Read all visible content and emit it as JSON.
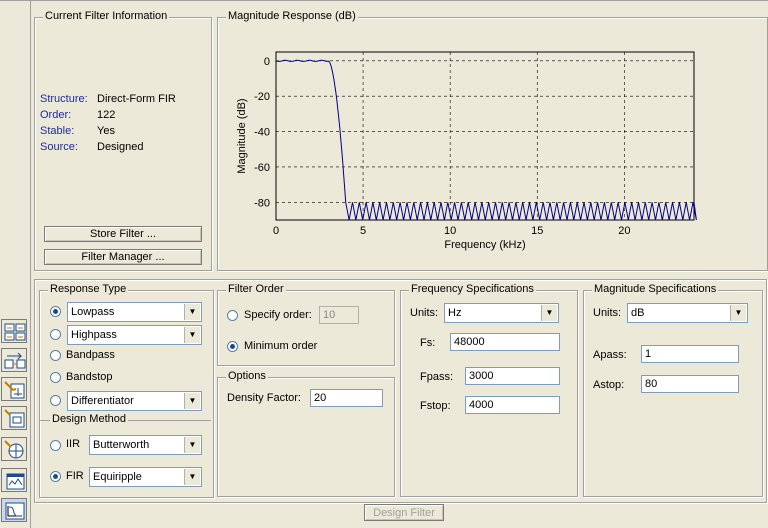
{
  "filter_info": {
    "title": "Current Filter Information",
    "rows": [
      {
        "label": "Structure:",
        "value": "Direct-Form FIR"
      },
      {
        "label": "Order:",
        "value": "122"
      },
      {
        "label": "Stable:",
        "value": "Yes"
      },
      {
        "label": "Source:",
        "value": "Designed"
      }
    ],
    "store_button": "Store Filter ...",
    "manager_button": "Filter Manager ..."
  },
  "plot": {
    "title": "Magnitude Response (dB)",
    "chart_data": {
      "type": "line",
      "xlabel": "Frequency (kHz)",
      "ylabel": "Magnitude (dB)",
      "xlim": [
        0,
        24
      ],
      "ylim": [
        -90,
        5
      ],
      "xticks": [
        "0",
        "5",
        "10",
        "15",
        "20"
      ],
      "yticks": [
        "0",
        "-20",
        "-40",
        "-60",
        "-80"
      ],
      "grid": true,
      "color": "#00008b",
      "passband_edge_khz": 3,
      "stopband_edge_khz": 4,
      "stopband_atten_db": -80
    }
  },
  "response_type": {
    "title": "Response Type",
    "options": [
      {
        "label": "Lowpass",
        "checked": true,
        "dropdown": true
      },
      {
        "label": "Highpass",
        "checked": false,
        "dropdown": true
      },
      {
        "label": "Bandpass",
        "checked": false,
        "dropdown": false
      },
      {
        "label": "Bandstop",
        "checked": false,
        "dropdown": false
      },
      {
        "label": "Differentiator",
        "checked": false,
        "dropdown": true
      }
    ]
  },
  "design_method": {
    "title": "Design Method",
    "iir_label": "IIR",
    "iir_value": "Butterworth",
    "fir_label": "FIR",
    "fir_value": "Equiripple"
  },
  "filter_order": {
    "title": "Filter Order",
    "specify_label": "Specify order:",
    "specify_value": "10",
    "minimum_label": "Minimum order"
  },
  "options": {
    "title": "Options",
    "density_label": "Density Factor:",
    "density_value": "20"
  },
  "freq_spec": {
    "title": "Frequency Specifications",
    "units_label": "Units:",
    "units_value": "Hz",
    "fs_label": "Fs:",
    "fs_value": "48000",
    "fpass_label": "Fpass:",
    "fpass_value": "3000",
    "fstop_label": "Fstop:",
    "fstop_value": "4000"
  },
  "mag_spec": {
    "title": "Magnitude Specifications",
    "units_label": "Units:",
    "units_value": "dB",
    "apass_label": "Apass:",
    "apass_value": "1",
    "astop_label": "Astop:",
    "astop_value": "80"
  },
  "design_button": "Design Filter",
  "toolbar_icons": [
    "design-filter-icon",
    "transform-filter-icon",
    "pole-zero-editor-icon",
    "import-filter-icon",
    "multirate-icon",
    "realize-model-icon",
    "analysis-icon"
  ]
}
